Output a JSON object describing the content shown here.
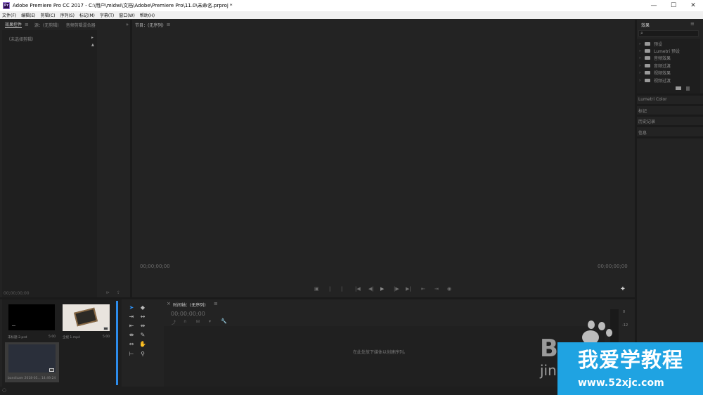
{
  "titlebar": {
    "icon_text": "Pr",
    "title": "Adobe Premiere Pro CC 2017 - C:\\用户\\midwi\\文档\\Adobe\\Premiere Pro\\11.0\\未命名.prproj *",
    "minimize": "—",
    "maximize": "☐",
    "close": "✕"
  },
  "menubar": {
    "items": [
      "文件(F)",
      "编辑(E)",
      "剪辑(C)",
      "序列(S)",
      "标记(M)",
      "字幕(T)",
      "窗口(W)",
      "帮助(H)"
    ]
  },
  "source_panel": {
    "tabs": [
      "效果控件",
      "源：(无剪辑)",
      "音频剪辑混合器"
    ],
    "menu_glyph": "≡",
    "overflow_glyph": "»",
    "no_clip_text": "（未选择剪辑）",
    "timecode": "00;00;00;00"
  },
  "program_panel": {
    "tab": "节目：(无序列)",
    "menu_glyph": "≡",
    "timecode_left": "00;00;00;00",
    "timecode_right": "00;00;00;00",
    "controls": [
      "▣",
      "|",
      "|",
      "|◀",
      "◀|",
      "▶",
      "|▶",
      "▶|",
      "⇤",
      "⇥",
      "◉"
    ],
    "add_button": "✚"
  },
  "effects_panel": {
    "title": "效果",
    "menu_glyph": "≡",
    "search_icon_glyph": "⌕",
    "items": [
      "预设",
      "Lumetri 预设",
      "音频效果",
      "音频过渡",
      "视频效果",
      "视频过渡"
    ],
    "sections": [
      "Lumetri Color",
      "标记",
      "历史记录",
      "信息"
    ]
  },
  "project_panel": {
    "items": [
      {
        "name": "未标题-2.psd",
        "duration": "5:00"
      },
      {
        "name": "全视 1.mp4",
        "duration": "5:00"
      },
      {
        "name": "bandicam 2018-05...",
        "duration": "14:49:24"
      }
    ]
  },
  "timeline_panel": {
    "close_glyph": "×",
    "tab": "时间轴：(无序列)",
    "menu_glyph": "≡",
    "timecode": "00;00;00;00",
    "empty_text": "在此处放下媒体以创建序列。",
    "meter_labels": [
      "0",
      "-12"
    ]
  },
  "watermark": {
    "main_text": "我爱学教程",
    "url": "www.52xjc.com",
    "bd_text": "B",
    "jin_text": "jin"
  },
  "colors": {
    "background": "#232323",
    "divider": "#1a1a1a",
    "accent": "#2d8ceb",
    "watermark_blue": "#1fa3e2"
  }
}
